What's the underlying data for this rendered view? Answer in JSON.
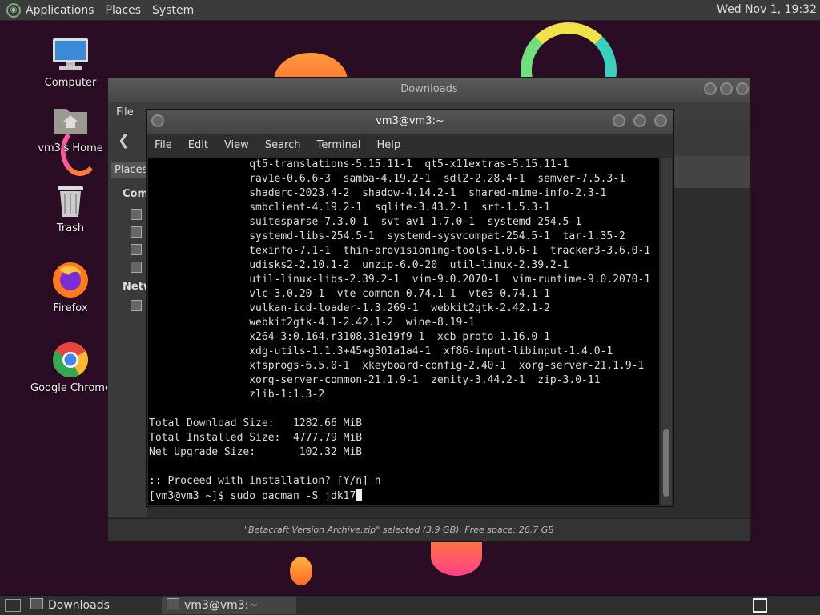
{
  "top_panel": {
    "menus": [
      "Applications",
      "Places",
      "System"
    ],
    "clock": "Wed Nov 1, 19:32"
  },
  "desktop_icons": [
    {
      "label": "Computer",
      "icon": "computer-icon"
    },
    {
      "label": "vm3's Home",
      "icon": "home-folder-icon"
    },
    {
      "label": "Trash",
      "icon": "trash-icon"
    },
    {
      "label": "Firefox",
      "icon": "firefox-icon"
    },
    {
      "label": "Google Chrome",
      "icon": "chrome-icon"
    }
  ],
  "downloads_window": {
    "title": "Downloads",
    "menu_file": "File",
    "places_tab": "Places",
    "section_computer": "Com",
    "section_network": "Netw",
    "status": "\"Betacraft Version Archive.zip\" selected (3.9 GB), Free space: 26.7 GB"
  },
  "terminal_window": {
    "title": "vm3@vm3:~",
    "menu": [
      "File",
      "Edit",
      "View",
      "Search",
      "Terminal",
      "Help"
    ],
    "lines": [
      "                qt5-translations-5.15.11-1  qt5-x11extras-5.15.11-1",
      "                rav1e-0.6.6-3  samba-4.19.2-1  sdl2-2.28.4-1  semver-7.5.3-1",
      "                shaderc-2023.4-2  shadow-4.14.2-1  shared-mime-info-2.3-1",
      "                smbclient-4.19.2-1  sqlite-3.43.2-1  srt-1.5.3-1",
      "                suitesparse-7.3.0-1  svt-av1-1.7.0-1  systemd-254.5-1",
      "                systemd-libs-254.5-1  systemd-sysvcompat-254.5-1  tar-1.35-2",
      "                texinfo-7.1-1  thin-provisioning-tools-1.0.6-1  tracker3-3.6.0-1",
      "                udisks2-2.10.1-2  unzip-6.0-20  util-linux-2.39.2-1",
      "                util-linux-libs-2.39.2-1  vim-9.0.2070-1  vim-runtime-9.0.2070-1",
      "                vlc-3.0.20-1  vte-common-0.74.1-1  vte3-0.74.1-1",
      "                vulkan-icd-loader-1.3.269-1  webkit2gtk-2.42.1-2",
      "                webkit2gtk-4.1-2.42.1-2  wine-8.19-1",
      "                x264-3:0.164.r3108.31e19f9-1  xcb-proto-1.16.0-1",
      "                xdg-utils-1.1.3+45+g301a1a4-1  xf86-input-libinput-1.4.0-1",
      "                xfsprogs-6.5.0-1  xkeyboard-config-2.40-1  xorg-server-21.1.9-1",
      "                xorg-server-common-21.1.9-1  zenity-3.44.2-1  zip-3.0-11",
      "                zlib-1:1.3-2",
      "",
      "Total Download Size:   1282.66 MiB",
      "Total Installed Size:  4777.79 MiB",
      "Net Upgrade Size:       102.32 MiB",
      "",
      ":: Proceed with installation? [Y/n] n"
    ],
    "prompt_line": "[vm3@vm3 ~]$ sudo pacman -S jdk17"
  },
  "taskbar": {
    "tasks": [
      {
        "label": "Downloads",
        "icon": "folder-icon"
      },
      {
        "label": "vm3@vm3:~",
        "icon": "terminal-icon"
      }
    ]
  },
  "colors": {
    "desktop_bg": "#2a0c24",
    "panel": "#3b3b3b",
    "terminal_bg": "#000000"
  }
}
